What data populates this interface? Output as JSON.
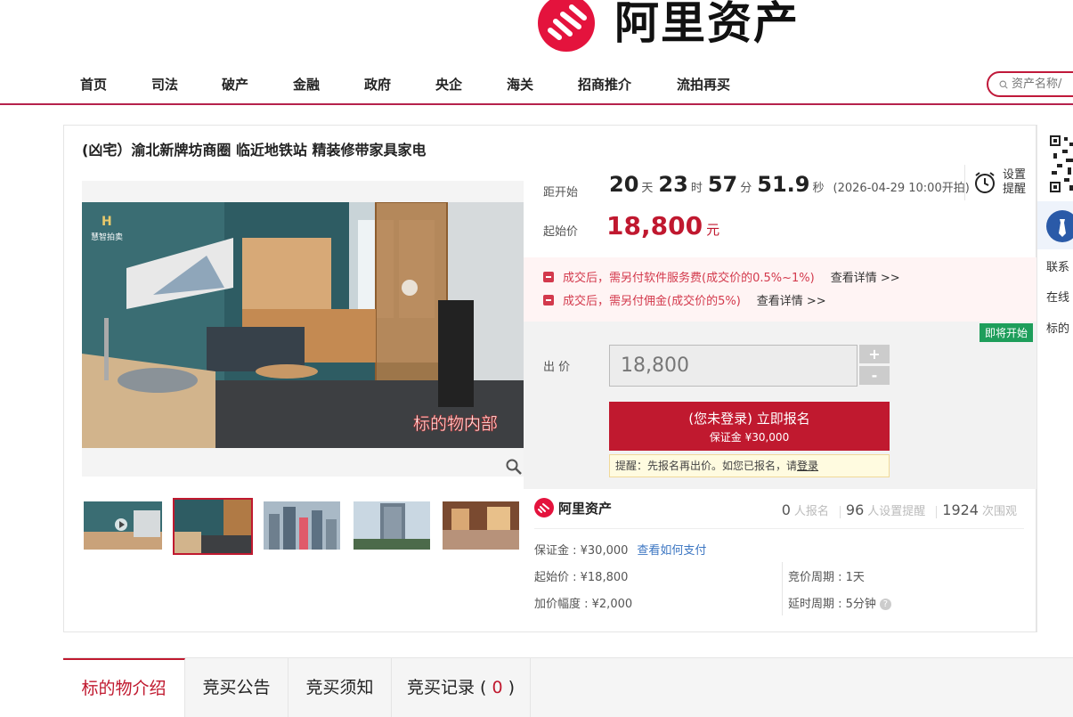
{
  "header": {
    "brand_name": "阿里资产",
    "nav": [
      "首页",
      "司法",
      "破产",
      "金融",
      "政府",
      "央企",
      "海关",
      "招商推介",
      "流拍再买"
    ],
    "search_placeholder": "资产名称/"
  },
  "item": {
    "title": "(凶宅）渝北新牌坊商圈 临近地铁站 精装修带家具家电",
    "photo_caption": "标的物内部",
    "photo_watermark": "慧智拍卖"
  },
  "countdown": {
    "label": "距开始",
    "days": "20",
    "days_unit": "天",
    "hours": "23",
    "hours_unit": "时",
    "minutes": "57",
    "minutes_unit": "分",
    "seconds": "51.9",
    "seconds_unit": "秒",
    "start_time": "(2026-04-29 10:00开拍)"
  },
  "reminder": {
    "line1": "设置",
    "line2": "提醒"
  },
  "price": {
    "label": "起始价",
    "value": "18,800",
    "unit": "元"
  },
  "fees": [
    {
      "text": "成交后，需另付软件服务费(成交价的0.5%~1%)",
      "link": "查看详情 >>"
    },
    {
      "text": "成交后，需另付佣金(成交价的5%)",
      "link": "查看详情 >>"
    }
  ],
  "bid": {
    "status_tag": "即将开始",
    "label": "出 价",
    "value": "18,800",
    "plus": "+",
    "minus": "-",
    "signup_line1": "(您未登录) 立即报名",
    "signup_line2": "保证金 ¥30,000",
    "tip_text": "提醒：先报名再出价。如您已报名，请",
    "tip_link": "登录"
  },
  "stats": {
    "brand": "阿里资产",
    "signups": "0",
    "signups_label": "人报名",
    "reminders": "96",
    "reminders_label": "人设置提醒",
    "views": "1924",
    "views_label": "次围观",
    "deposit": "保证金 : ¥30,000",
    "deposit_link": "查看如何支付",
    "start_price": "起始价 : ¥18,800",
    "increment": "加价幅度 : ¥2,000",
    "period": "竞价周期 : 1天",
    "delay": "延时周期 : 5分钟"
  },
  "side": {
    "line1": "联系",
    "line2": "在线",
    "line3": "标的"
  },
  "tabs": [
    {
      "label": "标的物介绍"
    },
    {
      "label": "竞买公告"
    },
    {
      "label": "竞买须知"
    },
    {
      "label": "竞买记录 (",
      "count": "0",
      "suffix": ")"
    }
  ]
}
